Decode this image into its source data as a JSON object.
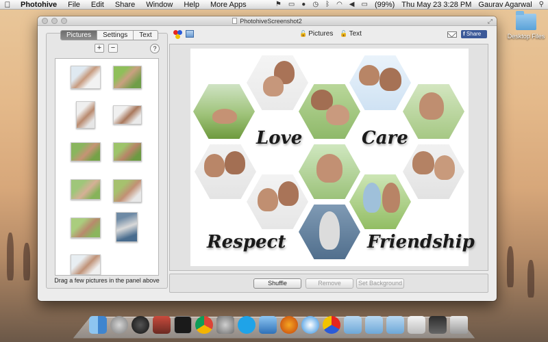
{
  "menubar": {
    "app_name": "Photohive",
    "menus": [
      "File",
      "Edit",
      "Share",
      "Window",
      "Help",
      "More Apps"
    ],
    "battery": "(99%)",
    "datetime": "Thu May 23  3:28 PM",
    "user": "Gaurav Agarwal"
  },
  "desktop": {
    "folder_label": "Desktop Files"
  },
  "window": {
    "title": "PhotohiveScreenshot2"
  },
  "left_panel": {
    "tabs": [
      "Pictures",
      "Settings",
      "Text"
    ],
    "active_tab": "Pictures",
    "add_label": "+",
    "remove_label": "−",
    "help_label": "?",
    "caption": "Drag a few pictures in the panel above"
  },
  "toolbar": {
    "pictures_label": "Pictures",
    "text_label": "Text",
    "share_label": "Share"
  },
  "collage": {
    "words": [
      "Love",
      "Care",
      "Respect",
      "Friendship"
    ]
  },
  "buttons": {
    "shuffle": "Shuffle",
    "remove": "Remove",
    "set_background": "Set Background"
  },
  "colors": {
    "facebook": "#3b5998",
    "active_tab": "#7a7a7a"
  }
}
